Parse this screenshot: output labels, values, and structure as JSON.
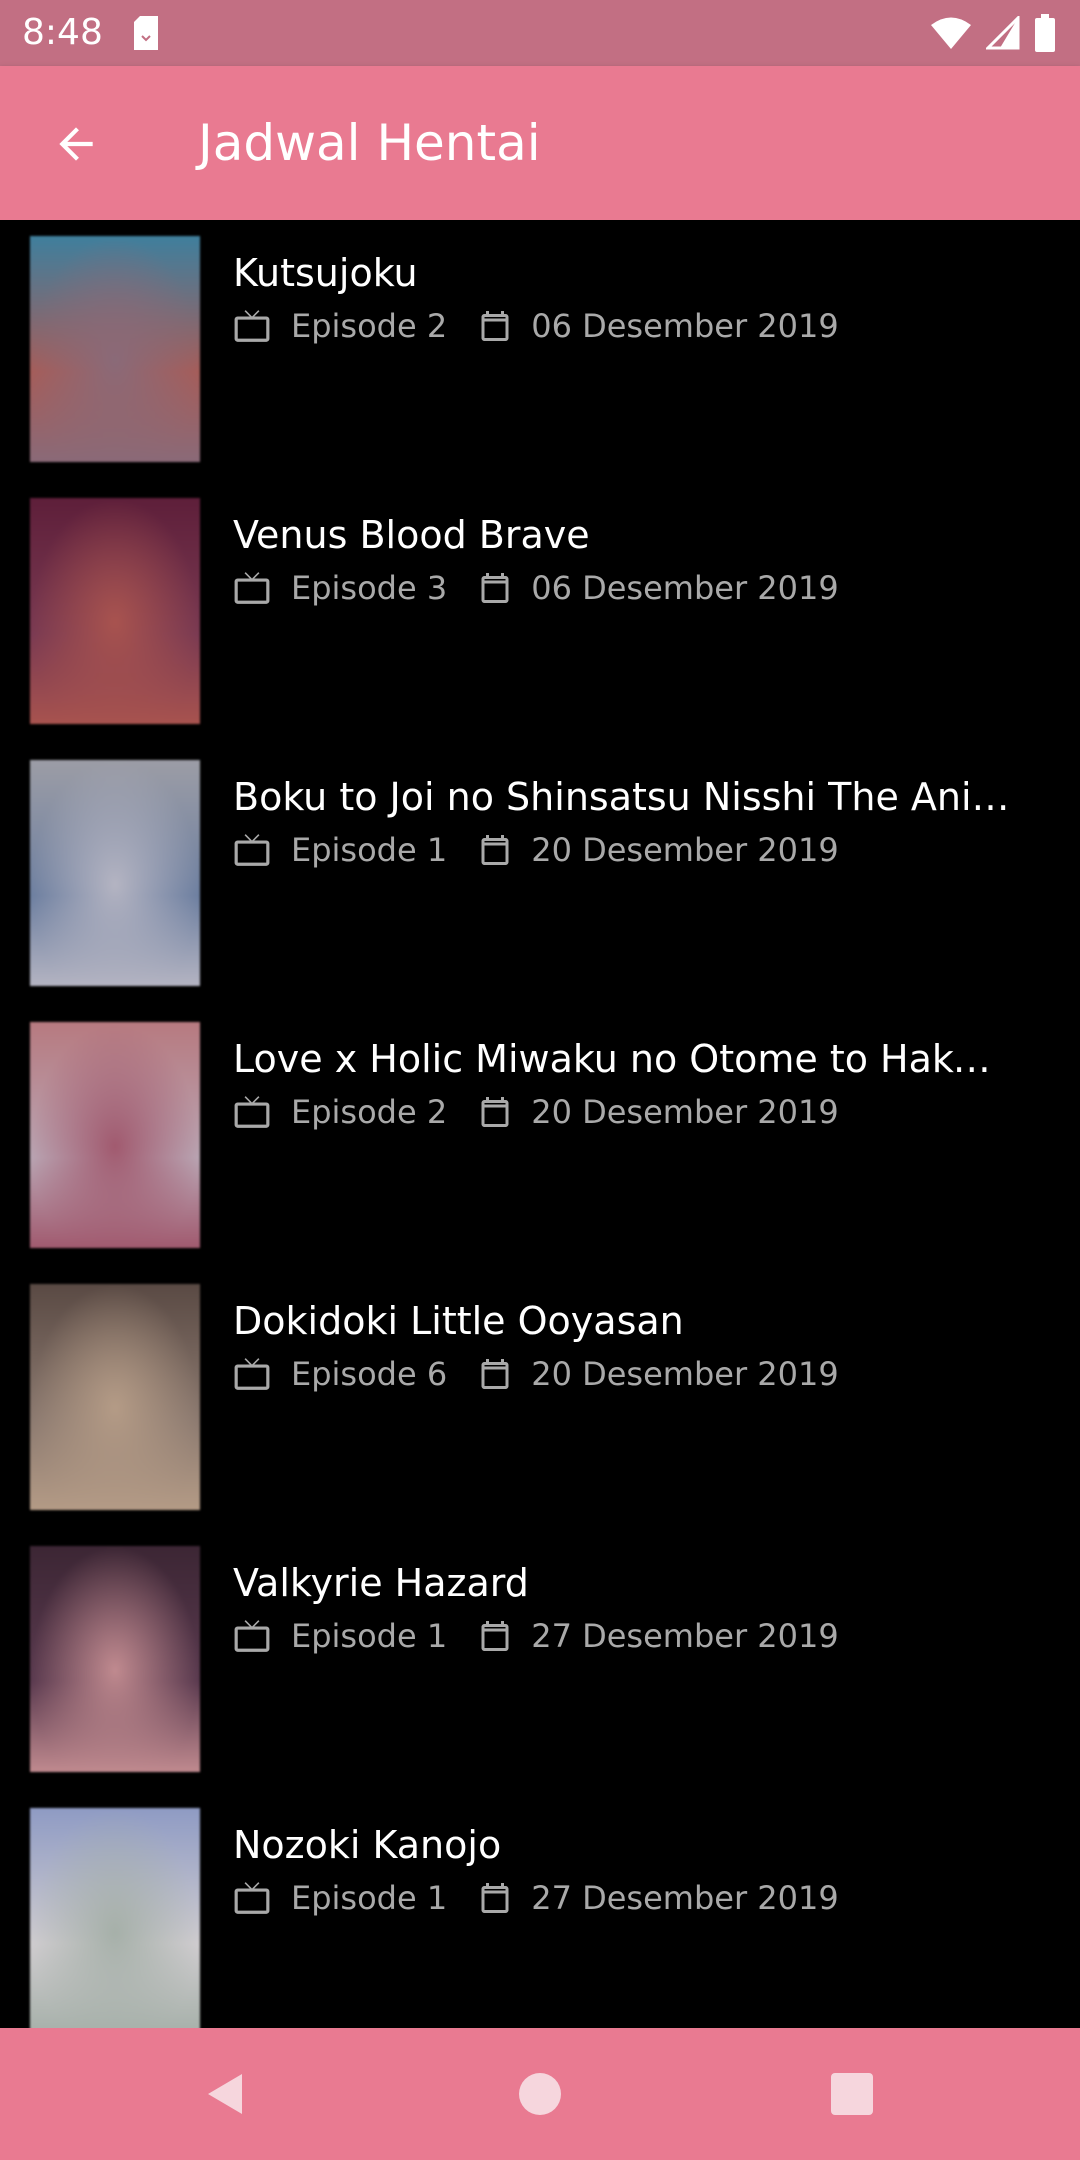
{
  "status_bar": {
    "time": "8:48",
    "icons": [
      "sd-card-icon",
      "wifi-icon",
      "cell-signal-icon",
      "battery-icon"
    ]
  },
  "app_bar": {
    "title": "Jadwal Hentai",
    "back_icon": "arrow-back-icon",
    "color": "#e97a91"
  },
  "schedule": [
    {
      "title": "Kutsujoku",
      "episode": "Episode 2",
      "date": "06 Desember 2019",
      "thumb_colors": [
        "#3f7f9d",
        "#8a6a78",
        "#a55d5a"
      ]
    },
    {
      "title": "Venus Blood Brave",
      "episode": "Episode 3",
      "date": "06 Desember 2019",
      "thumb_colors": [
        "#5e1f3a",
        "#a8534f",
        "#7a3a52"
      ]
    },
    {
      "title": "Boku to Joi no Shinsatsu Nisshi The Animation",
      "episode": "Episode 1",
      "date": "20 Desember 2019",
      "thumb_colors": [
        "#9c9da6",
        "#b4b4c2",
        "#6d7fa0"
      ]
    },
    {
      "title": "Love x Holic Miwaku no Otome to Hakudaku Kankei",
      "episode": "Episode 2",
      "date": "20 Desember 2019",
      "thumb_colors": [
        "#b77a80",
        "#a15a6f",
        "#b9a4b2"
      ]
    },
    {
      "title": "Dokidoki Little Ooyasan",
      "episode": "Episode 6",
      "date": "20 Desember 2019",
      "thumb_colors": [
        "#5a4a44",
        "#b49b86",
        "#8c7a70"
      ]
    },
    {
      "title": "Valkyrie Hazard",
      "episode": "Episode 1",
      "date": "27 Desember 2019",
      "thumb_colors": [
        "#3c2634",
        "#c08a8f",
        "#5a3a4f"
      ]
    },
    {
      "title": "Nozoki Kanojo",
      "episode": "Episode 1",
      "date": "27 Desember 2019",
      "thumb_colors": [
        "#8f9bc4",
        "#a6b0a9",
        "#cfcccf"
      ]
    }
  ],
  "icons": {
    "episode": "tv-icon",
    "date": "calendar-icon"
  },
  "nav_bar": {
    "buttons": [
      "nav-back-icon",
      "nav-home-icon",
      "nav-recents-icon"
    ],
    "color": "#e97a91"
  }
}
